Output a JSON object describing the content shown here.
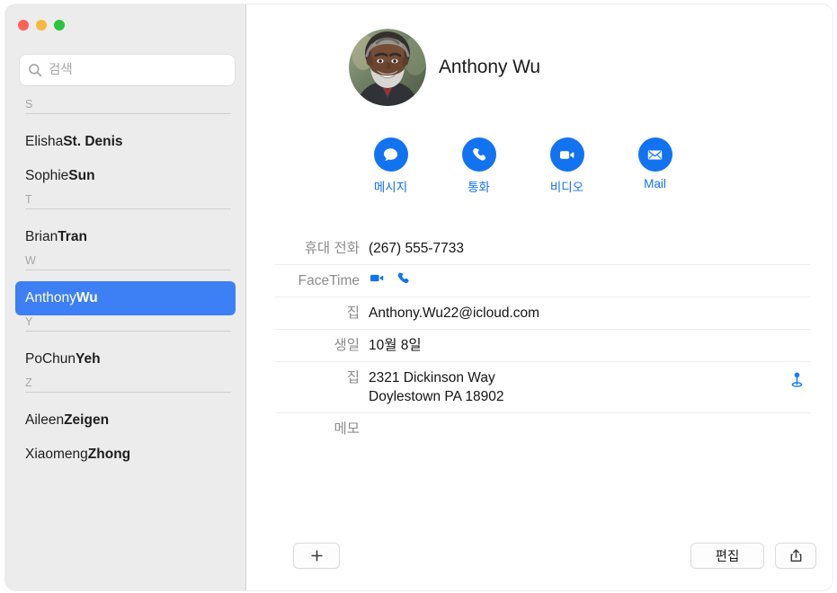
{
  "window": {
    "traffic_lights": [
      {
        "name": "close",
        "color": "#ff6159"
      },
      {
        "name": "minimize",
        "color": "#f6b93f"
      },
      {
        "name": "zoom",
        "color": "#2ac53e"
      }
    ]
  },
  "sidebar": {
    "search": {
      "placeholder": "검색",
      "value": "",
      "icon": "search-icon"
    },
    "sections": [
      {
        "letter": "S",
        "contacts": [
          {
            "given": "Elisha ",
            "family": "St. Denis",
            "selected": false
          },
          {
            "given": "Sophie ",
            "family": "Sun",
            "selected": false
          }
        ]
      },
      {
        "letter": "T",
        "contacts": [
          {
            "given": "Brian ",
            "family": "Tran",
            "selected": false
          }
        ]
      },
      {
        "letter": "W",
        "contacts": [
          {
            "given": "Anthony ",
            "family": "Wu",
            "selected": true
          }
        ]
      },
      {
        "letter": "Y",
        "contacts": [
          {
            "given": "PoChun ",
            "family": "Yeh",
            "selected": false
          }
        ]
      },
      {
        "letter": "Z",
        "contacts": [
          {
            "given": "Aileen ",
            "family": "Zeigen",
            "selected": false
          },
          {
            "given": "Xiaomeng ",
            "family": "Zhong",
            "selected": false
          }
        ]
      }
    ],
    "selection_color": "#3d7ff5",
    "background_color": "#ececec"
  },
  "detail": {
    "contact_name": "Anthony Wu",
    "avatar": {
      "icon": "avatar",
      "alt": "Anthony Wu"
    },
    "actions": [
      {
        "label": "메시지",
        "icon": "message-icon"
      },
      {
        "label": "통화",
        "icon": "phone-icon"
      },
      {
        "label": "비디오",
        "icon": "video-icon"
      },
      {
        "label": "Mail",
        "icon": "mail-icon"
      }
    ],
    "accent_color": "#1273f0",
    "fields": [
      {
        "label": "휴대 전화",
        "type": "text",
        "value": "(267) 555-7733"
      },
      {
        "label": "FaceTime",
        "type": "icons",
        "icons": [
          "facetime-video-icon",
          "facetime-audio-icon"
        ]
      },
      {
        "label": "집",
        "type": "text",
        "value": "Anthony.Wu22@icloud.com"
      },
      {
        "label": "생일",
        "type": "text",
        "value": "10월 8일"
      },
      {
        "label": "집",
        "type": "address",
        "lines": [
          "2321 Dickinson Way",
          "Doylestown PA 18902"
        ],
        "trailing_icon": "map-pin-icon"
      },
      {
        "label": "메모",
        "type": "text",
        "value": ""
      }
    ]
  },
  "toolbar": {
    "add_label": "+",
    "add_icon": "plus-icon",
    "edit_label": "편집",
    "share_icon": "share-icon"
  }
}
